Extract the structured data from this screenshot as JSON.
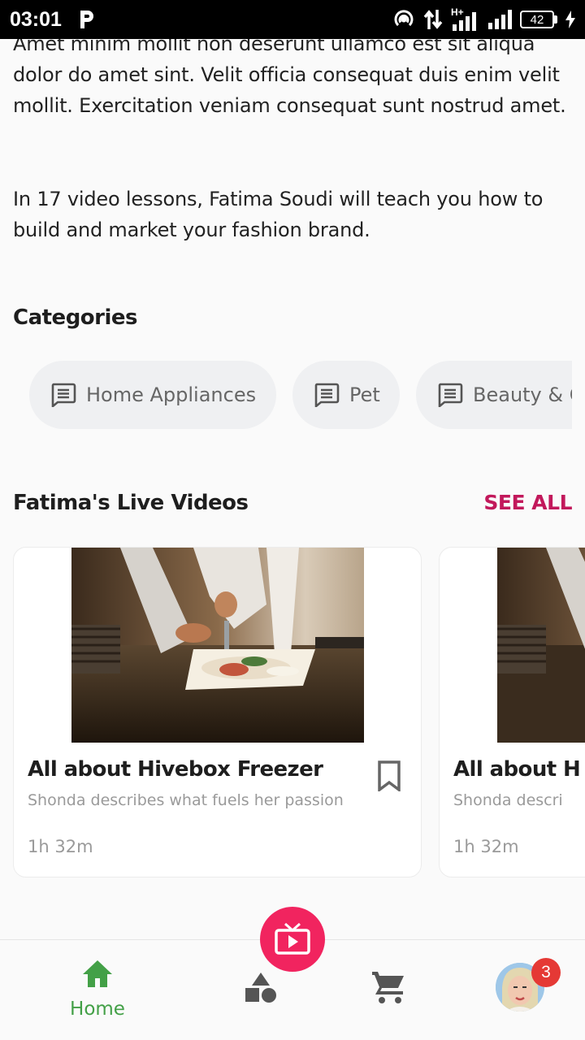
{
  "status_bar": {
    "time": "03:01",
    "network": "H+",
    "battery": "42"
  },
  "description": {
    "paragraph_1": "Amet minim mollit non deserunt ullamco est sit aliqua dolor do amet sint. Velit officia consequat duis enim velit mollit. Exercitation veniam consequat sunt nostrud amet.",
    "paragraph_2": "In 17 video lessons, Fatima Soudi will teach you how to build and market your fashion brand."
  },
  "categories": {
    "title": "Categories",
    "items": [
      {
        "label": "Home Appliances",
        "icon": "message-icon"
      },
      {
        "label": "Pet",
        "icon": "message-icon"
      },
      {
        "label": "Beauty & C",
        "icon": "message-icon"
      }
    ]
  },
  "live_videos": {
    "title": "Fatima's Live Videos",
    "see_all": "SEE ALL",
    "cards": [
      {
        "title": "All about Hivebox Freezer",
        "subtitle": "Shonda describes what fuels her passion",
        "duration": "1h 32m"
      },
      {
        "title": "All about H",
        "subtitle": "Shonda descri",
        "duration": "1h 32m"
      }
    ]
  },
  "bottom_nav": {
    "home_label": "Home",
    "badge_count": "3",
    "icons": [
      "home-icon",
      "shapes-icon",
      "cart-icon",
      "avatar"
    ],
    "fab_icon": "live-tv-icon"
  },
  "colors": {
    "accent": "#f1245f",
    "see_all": "#c2185b",
    "home_active": "#43a047",
    "badge": "#e53935"
  }
}
